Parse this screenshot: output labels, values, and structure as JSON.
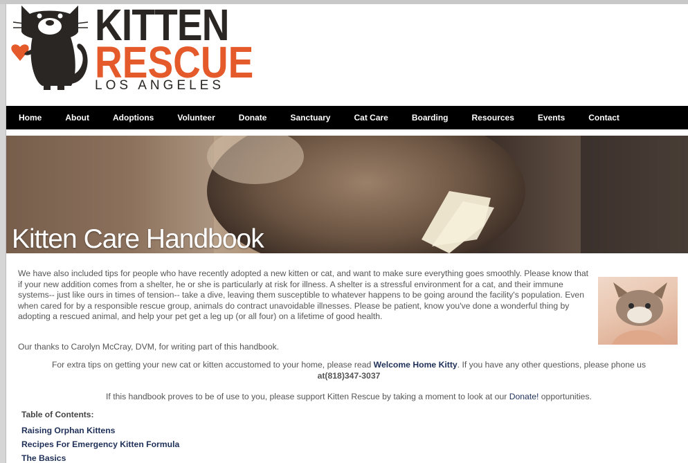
{
  "logo": {
    "line1": "KITTEN",
    "line2": "RESCUE",
    "line3": "LOS ANGELES"
  },
  "nav": {
    "items": [
      "Home",
      "About",
      "Adoptions",
      "Volunteer",
      "Donate",
      "Sanctuary",
      "Cat Care",
      "Boarding",
      "Resources",
      "Events",
      "Contact"
    ]
  },
  "banner": {
    "title": "Kitten Care Handbook"
  },
  "content": {
    "intro": "We have also included tips for people who have recently adopted a new kitten or cat, and want to make sure everything goes smoothly. Please know that if your new addition comes from a shelter, he or she is particularly at risk for illness. A shelter is a stressful environment for a cat, and their immune systems-- just like ours in times of tension-- take a dive, leaving them susceptible to whatever happens to be going around the facility's population. Even when cared for by a responsible rescue group, animals do contract unavoidable illnesses. Please be patient, know you've done a wonderful thing by adopting a rescued animal, and help your pet get a leg up (or all four) on a lifetime of good health.",
    "thanks": "Our thanks to Carolyn McCray, DVM, for writing part of this handbook.",
    "tips_before": "For extra tips on getting your new cat or kitten accustomed to your home, please read ",
    "tips_link": "Welcome Home Kitty",
    "tips_after": ". If you have any other questions, please phone us",
    "tips_phone": "at(818)347-3037",
    "support_before": "If this handbook proves to be of use to you, please support Kitten Rescue by taking a moment to look at our ",
    "support_link": "Donate!",
    "support_after": " opportunities.",
    "toc_title": "Table of Contents:",
    "toc": [
      "Raising Orphan Kittens",
      "Recipes For Emergency Kitten Formula",
      "The Basics"
    ]
  },
  "colors": {
    "accent": "#e55a2b",
    "nav_bg": "#000000",
    "link": "#1f3058",
    "text": "#555555"
  }
}
